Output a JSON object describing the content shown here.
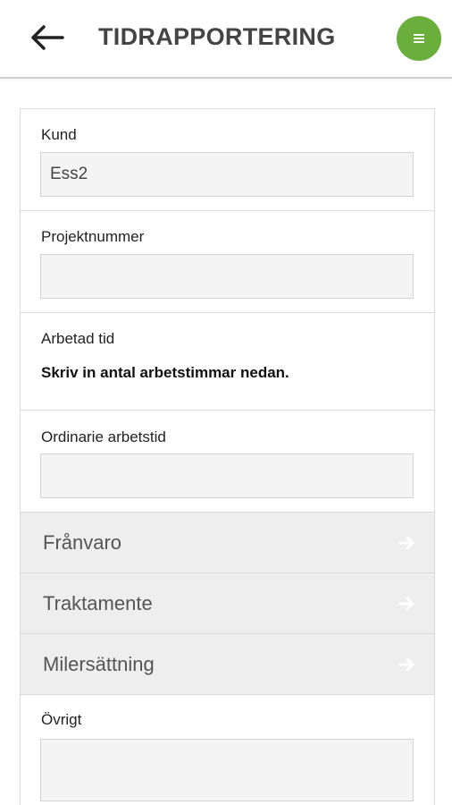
{
  "header": {
    "title": "TIDRAPPORTERING",
    "back_icon": "arrow-left-icon",
    "menu_icon": "hamburger-menu-icon",
    "menu_color": "#6aae3c"
  },
  "form": {
    "kund": {
      "label": "Kund",
      "value": "Ess2"
    },
    "projektnummer": {
      "label": "Projektnummer",
      "value": ""
    },
    "arbetad_tid": {
      "label": "Arbetad tid",
      "instruction": "Skriv in antal arbetstimmar nedan."
    },
    "ordinarie": {
      "label": "Ordinarie arbetstid",
      "value": ""
    },
    "nav_items": [
      {
        "label": "Frånvaro"
      },
      {
        "label": "Traktamente"
      },
      {
        "label": "Milersättning"
      }
    ],
    "ovrigt": {
      "label": "Övrigt",
      "value": ""
    }
  }
}
